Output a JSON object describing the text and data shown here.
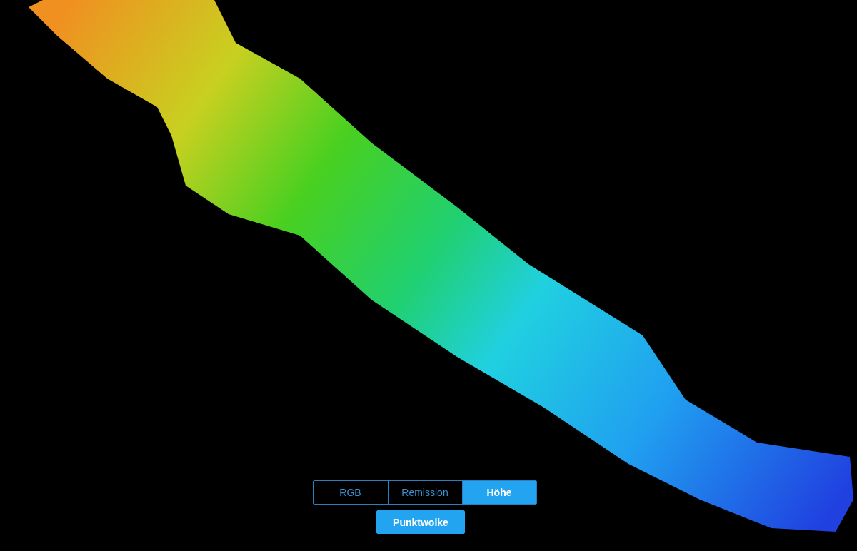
{
  "view_modes": [
    {
      "label": "RGB",
      "selected": false
    },
    {
      "label": "Remission",
      "selected": false
    },
    {
      "label": "Höhe",
      "selected": true
    }
  ],
  "point_cloud_button": {
    "label": "Punktwolke",
    "selected": true
  }
}
